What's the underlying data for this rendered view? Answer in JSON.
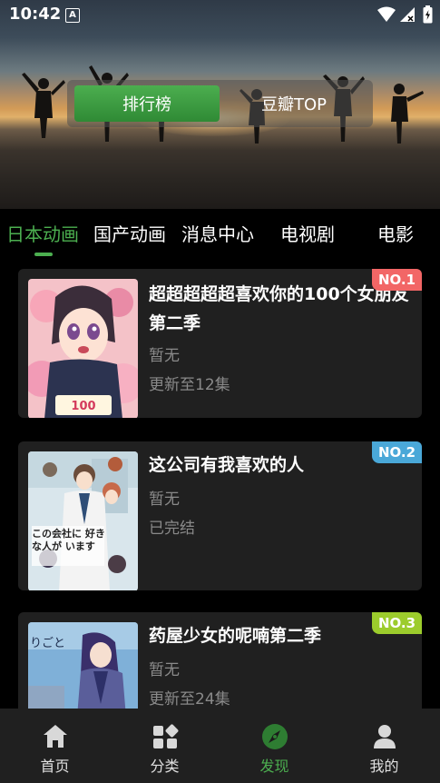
{
  "status_bar": {
    "time": "10:42",
    "notif_icon": "A"
  },
  "hero": {
    "rank_button": "排行榜",
    "douban_button": "豆瓣TOP"
  },
  "tabs": [
    "日本动画",
    "国产动画",
    "消息中心",
    "电视剧",
    "电影"
  ],
  "active_tab": 0,
  "cards": [
    {
      "title": "超超超超超喜欢你的100个女朋友第二季",
      "sub1": "暂无",
      "sub2": "更新至12集",
      "badge": "NO.1",
      "badge_color": "#f26666"
    },
    {
      "title": "这公司有我喜欢的人",
      "sub1": "暂无",
      "sub2": "已完结",
      "badge": "NO.2",
      "badge_color": "#4aa8d8"
    },
    {
      "title": "药屋少女的呢喃第二季",
      "sub1": "暂无",
      "sub2": "更新至24集",
      "badge": "NO.3",
      "badge_color": "#9ccc2c"
    }
  ],
  "card_art_text": {
    "card2": "この会社に 好きな人が います",
    "card3": "りごと"
  },
  "nav": [
    {
      "label": "首页",
      "icon": "home-icon"
    },
    {
      "label": "分类",
      "icon": "category-icon"
    },
    {
      "label": "发现",
      "icon": "compass-icon"
    },
    {
      "label": "我的",
      "icon": "user-icon"
    }
  ],
  "active_nav": 2,
  "colors": {
    "accent": "#4caf50",
    "card_bg": "#202020",
    "nav_bg": "#202020"
  }
}
